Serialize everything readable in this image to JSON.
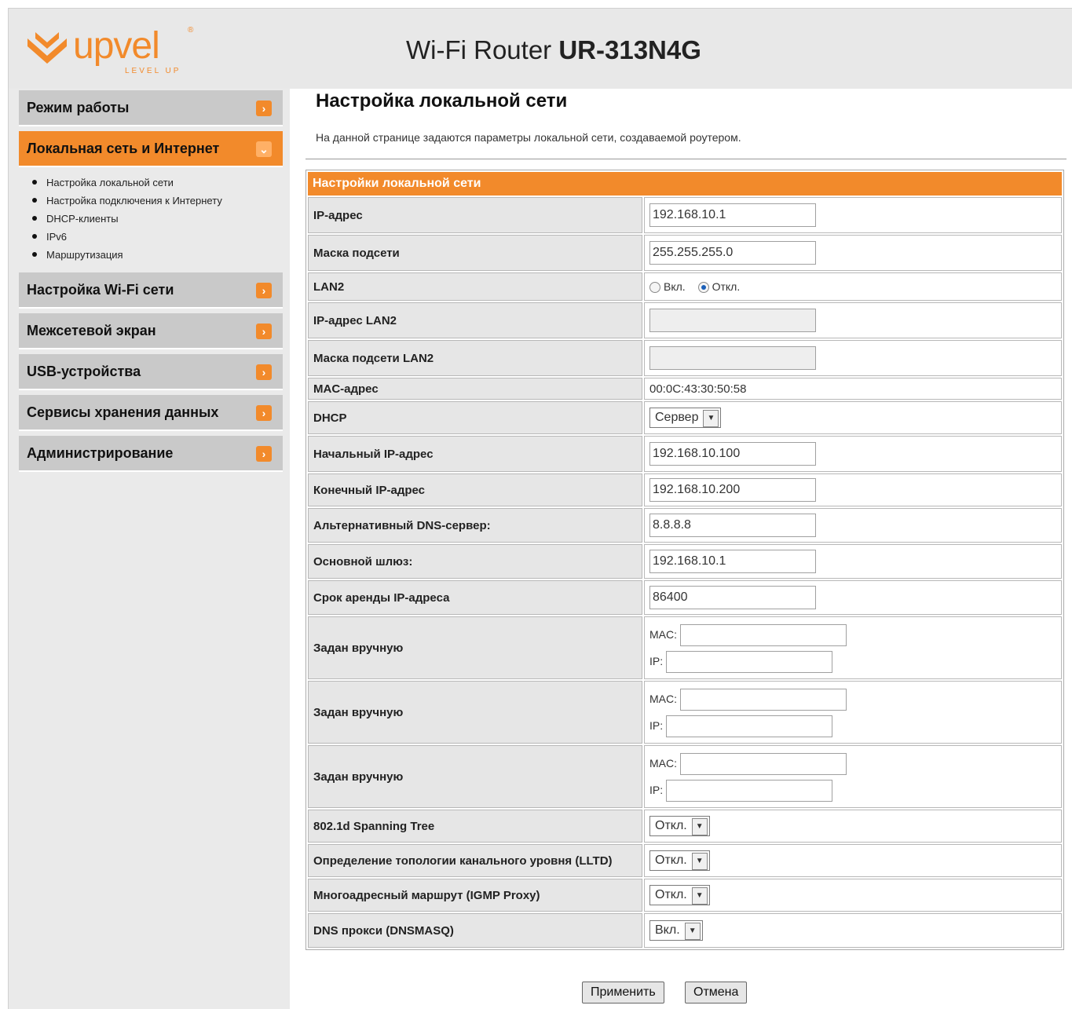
{
  "header": {
    "title_main": "Wi-Fi Router ",
    "title_model": "UR-313N4G",
    "logo_text": "upvel",
    "logo_tagline": "LEVEL UP",
    "logo_reg": "®"
  },
  "sidebar": {
    "items": [
      {
        "label": "Режим работы"
      },
      {
        "label": "Локальная сеть и Интернет",
        "active": true
      },
      {
        "label": "Настройка Wi-Fi сети"
      },
      {
        "label": "Межсетевой экран"
      },
      {
        "label": "USB-устройства"
      },
      {
        "label": "Сервисы хранения данных"
      },
      {
        "label": "Администрирование"
      }
    ],
    "subitems": [
      "Настройка локальной сети",
      "Настройка подключения к Интернету",
      "DHCP-клиенты",
      "IPv6",
      "Маршрутизация"
    ]
  },
  "page": {
    "title": "Настройка локальной сети",
    "description": "На данной странице задаются параметры локальной сети, создаваемой роутером.",
    "section_header": "Настройки локальной сети"
  },
  "form": {
    "ip_label": "IP-адрес",
    "ip_value": "192.168.10.1",
    "mask_label": "Маска подсети",
    "mask_value": "255.255.255.0",
    "lan2_label": "LAN2",
    "lan2_on": "Вкл.",
    "lan2_off": "Откл.",
    "lan2_ip_label": "IP-адрес LAN2",
    "lan2_mask_label": "Маска подсети LAN2",
    "mac_label": "MAC-адрес",
    "mac_value": "00:0C:43:30:50:58",
    "dhcp_label": "DHCP",
    "dhcp_value": "Сервер",
    "start_label": "Начальный IP-адрес",
    "start_value": "192.168.10.100",
    "end_label": "Конечный IP-адрес",
    "end_value": "192.168.10.200",
    "dns_label": "Альтернативный DNS-сервер:",
    "dns_value": "8.8.8.8",
    "gw_label": "Основной шлюз:",
    "gw_value": "192.168.10.1",
    "lease_label": "Срок аренды IP-адреса",
    "lease_value": "86400",
    "manual_label": "Задан вручную",
    "mac_small": "MAC:",
    "ip_small": "IP:",
    "stp_label": "802.1d Spanning Tree",
    "stp_value": "Откл.",
    "lltd_label": "Определение топологии канального уровня (LLTD)",
    "lltd_value": "Откл.",
    "igmp_label": "Многоадресный маршрут (IGMP Proxy)",
    "igmp_value": "Откл.",
    "dnsmasq_label": "DNS прокси (DNSMASQ)",
    "dnsmasq_value": "Вкл."
  },
  "buttons": {
    "apply": "Применить",
    "cancel": "Отмена"
  },
  "colors": {
    "accent": "#f28a2b",
    "header_bg": "#e8e8e8",
    "sidebar_bg": "#eaeaea",
    "label_bg": "#e6e6e6"
  }
}
